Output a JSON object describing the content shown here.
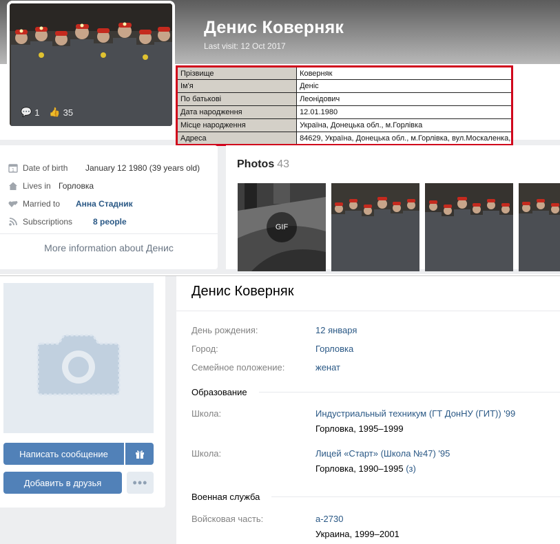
{
  "top": {
    "name": "Денис Коверняк",
    "last_visit": "Last visit: 12 Oct 2017",
    "avatar_stats": {
      "comments": "1",
      "likes": "35"
    },
    "table": [
      {
        "key": "Прізвище",
        "value": "Коверняк"
      },
      {
        "key": "Ім'я",
        "value": "Деніс"
      },
      {
        "key": "По батькові",
        "value": "Леонідович"
      },
      {
        "key": "Дата народження",
        "value": "12.01.1980"
      },
      {
        "key": "Місце народження",
        "value": "Україна, Донецька обл., м.Горлівка"
      },
      {
        "key": "Адреса",
        "value": "84629, Україна, Донецька обл., м.Горлівка, вул.Москаленка,"
      }
    ],
    "info": {
      "dob_label": "Date of birth",
      "dob_value": "January 12 1980 (39 years old)",
      "lives_label": "Lives in",
      "lives_value": "Горловка",
      "married_label": "Married to",
      "married_value": "Анна Стадник",
      "subs_label": "Subscriptions",
      "subs_value": "8 people",
      "more": "More information about Денис"
    },
    "photos": {
      "title": "Photos",
      "count": "43",
      "gif_label": "GIF"
    }
  },
  "bottom": {
    "name": "Денис Коверняк",
    "buttons": {
      "message": "Написать сообщение",
      "add_friend": "Добавить в друзья",
      "more": "•••"
    },
    "birthday_label": "День рождения:",
    "birthday_value": "12 января",
    "city_label": "Город:",
    "city_value": "Горловка",
    "family_label": "Семейное положение:",
    "family_value": "женат",
    "education_title": "Образование",
    "school1_label": "Школа:",
    "school1_value": "Индустриальный техникум (ГТ ДонНУ (ГИТ)) '99",
    "school1_sub": "Горловка, 1995–1999",
    "school2_label": "Школа:",
    "school2_value": "Лицей «Старт» (Школа №47) '95",
    "school2_sub": "Горловка, 1990–1995",
    "school2_link": "(з)",
    "military_title": "Военная служба",
    "unit_label": "Войсковая часть:",
    "unit_value": "а-2730",
    "unit_sub": "Украина, 1999–2001"
  },
  "colors": {
    "accent": "#5181b8",
    "link": "#2a5885",
    "highlight_border": "#d0021b"
  }
}
